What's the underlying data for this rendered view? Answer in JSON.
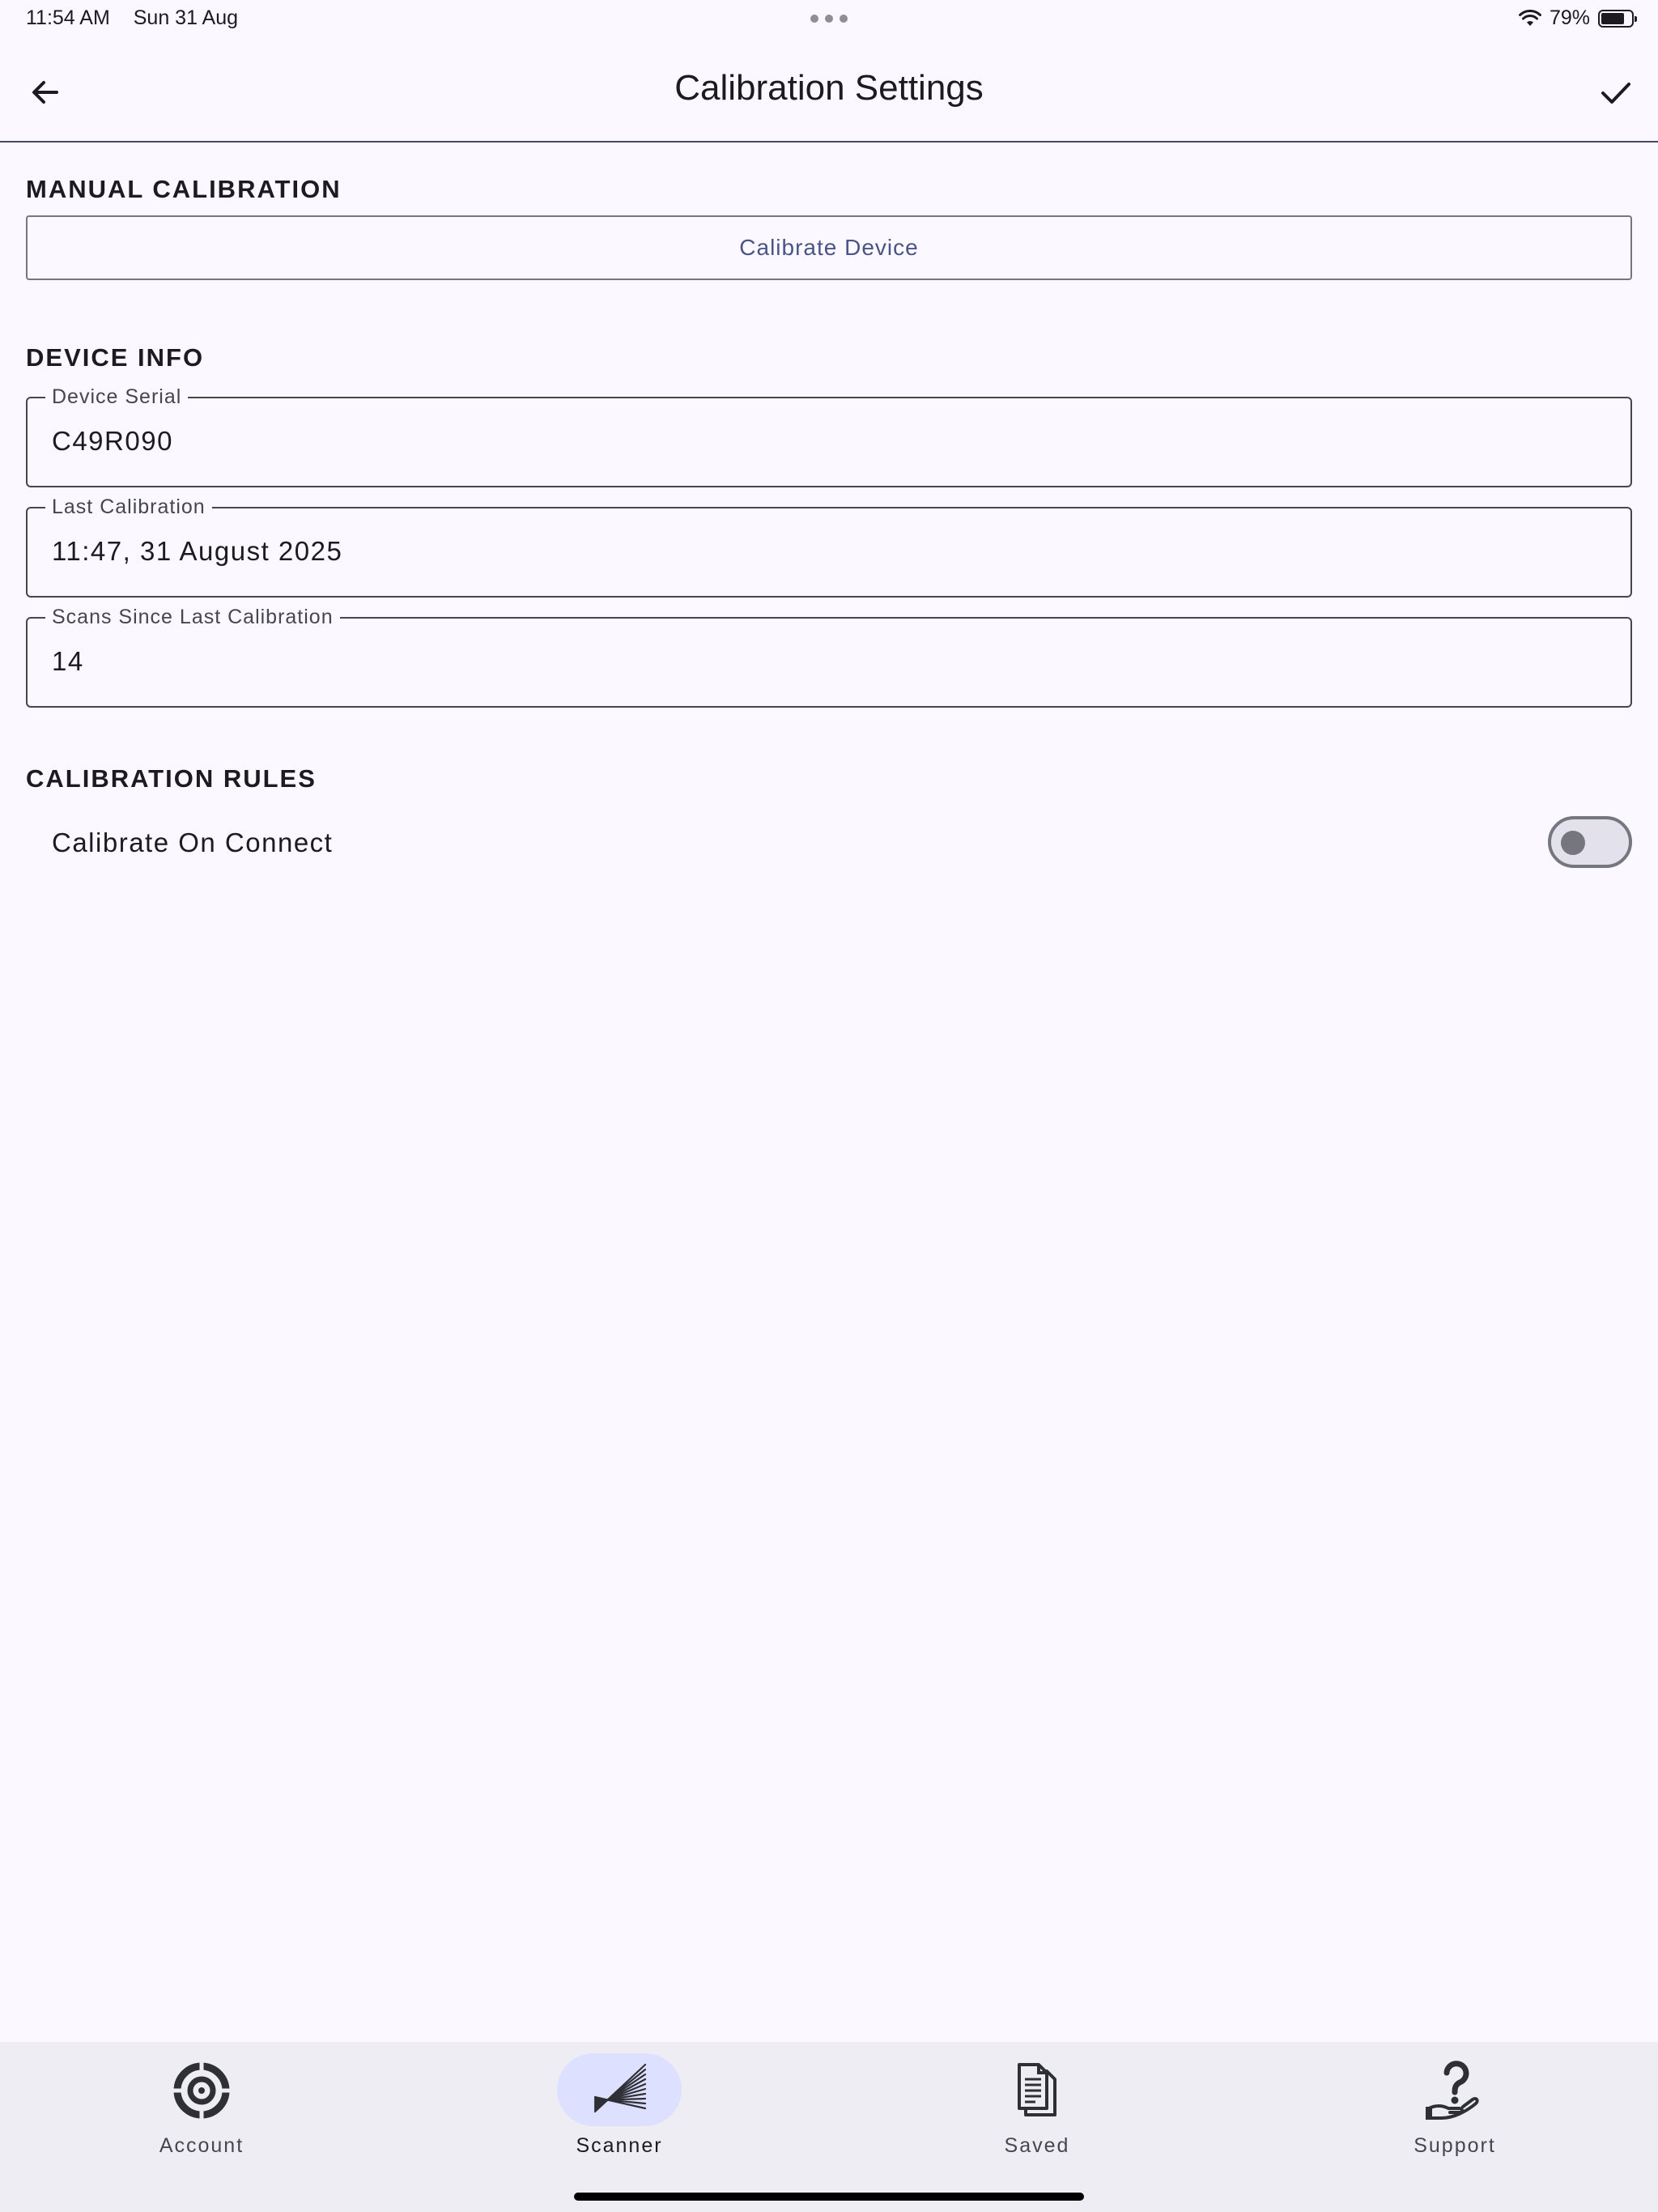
{
  "status_bar": {
    "time": "11:54 AM",
    "date": "Sun 31 Aug",
    "battery": "79%",
    "battery_level": 0.79
  },
  "app_bar": {
    "title": "Calibration Settings",
    "back_icon": "arrow-left-icon",
    "done_icon": "checkmark-icon"
  },
  "manual_calibration": {
    "title": "MANUAL CALIBRATION",
    "button_label": "Calibrate Device"
  },
  "device_info": {
    "title": "DEVICE INFO",
    "fields": [
      {
        "label": "Device Serial",
        "value": "C49R090"
      },
      {
        "label": "Last Calibration",
        "value": "11:47, 31 August 2025"
      },
      {
        "label": "Scans Since Last Calibration",
        "value": "14"
      }
    ]
  },
  "calibration_rules": {
    "title": "CALIBRATION RULES",
    "rules": [
      {
        "label": "Calibrate On Connect",
        "enabled": false
      }
    ]
  },
  "bottom_nav": {
    "items": [
      {
        "label": "Account",
        "icon": "target-icon",
        "active": false
      },
      {
        "label": "Scanner",
        "icon": "scanner-icon",
        "active": true
      },
      {
        "label": "Saved",
        "icon": "document-icon",
        "active": false
      },
      {
        "label": "Support",
        "icon": "help-hand-icon",
        "active": false
      }
    ]
  },
  "colors": {
    "background": "#fbf8ff",
    "accent": "#4a5488",
    "nav_background": "#efedf4",
    "active_pill": "#dee0ff"
  }
}
